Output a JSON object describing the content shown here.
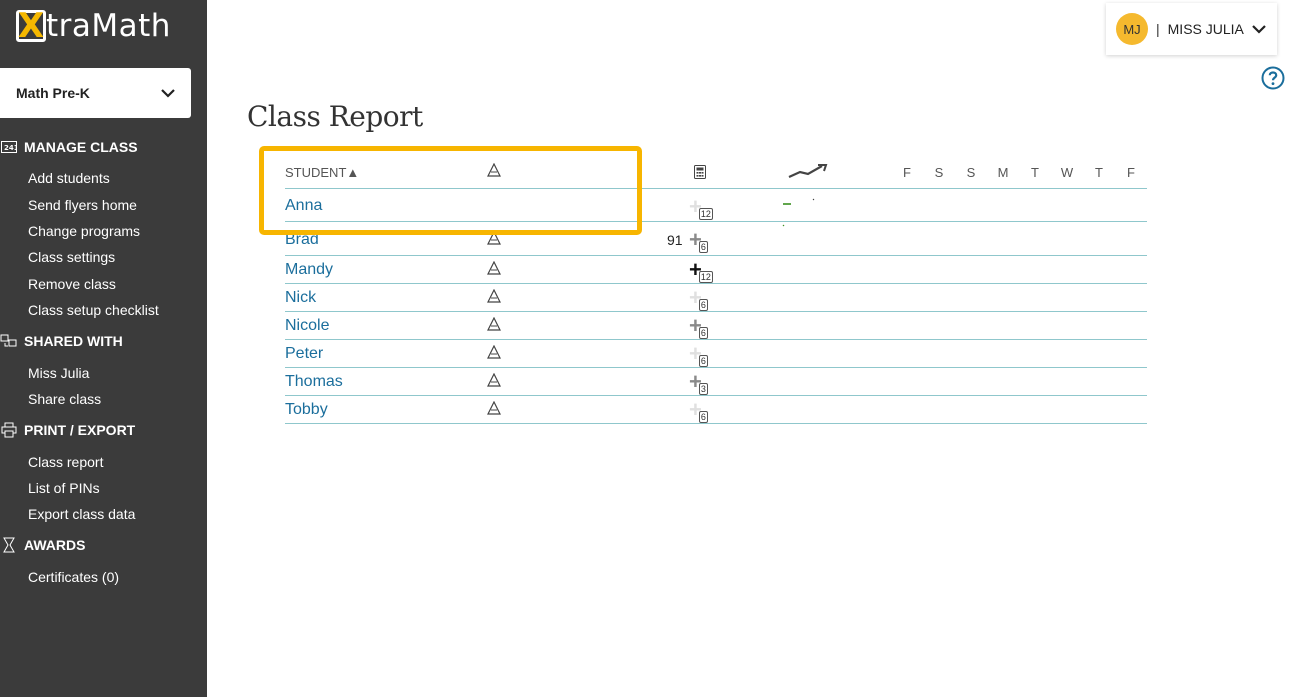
{
  "sidebar": {
    "logo": {
      "mark": "X",
      "text": "traMath"
    },
    "program": "Math Pre-K",
    "sections": [
      {
        "title": "MANAGE CLASS",
        "icon": "class-icon",
        "items": [
          "Add students",
          "Send flyers home",
          "Change programs",
          "Class settings",
          "Remove class",
          "Class setup checklist"
        ]
      },
      {
        "title": "SHARED WITH",
        "icon": "shared-icon",
        "items": [
          "Miss Julia",
          "Share class"
        ]
      },
      {
        "title": "PRINT / EXPORT",
        "icon": "printer-icon",
        "items": [
          "Class report",
          "List of PINs",
          "Export class data"
        ]
      },
      {
        "title": "AWARDS",
        "icon": "trophy-icon",
        "items": [
          "Certificates (0)"
        ]
      }
    ]
  },
  "user": {
    "initials": "MJ",
    "separator": "|",
    "name": "MISS JULIA"
  },
  "page": {
    "title": "Class Report"
  },
  "table": {
    "student_header": "STUDENT▲",
    "days": [
      "F",
      "S",
      "S",
      "M",
      "T",
      "W",
      "T",
      "F"
    ],
    "rows": [
      {
        "name": "Anna",
        "fluency_icon": false,
        "score": "",
        "op_style": "light",
        "badge": "12"
      },
      {
        "name": "Brad",
        "fluency_icon": true,
        "score": "91",
        "op_style": "mid",
        "badge": "6"
      },
      {
        "name": "Mandy",
        "fluency_icon": true,
        "score": "",
        "op_style": "dark",
        "badge": "12"
      },
      {
        "name": "Nick",
        "fluency_icon": true,
        "score": "",
        "op_style": "light",
        "badge": "6"
      },
      {
        "name": "Nicole",
        "fluency_icon": true,
        "score": "",
        "op_style": "mid",
        "badge": "6"
      },
      {
        "name": "Peter",
        "fluency_icon": true,
        "score": "",
        "op_style": "light",
        "badge": "6"
      },
      {
        "name": "Thomas",
        "fluency_icon": true,
        "score": "",
        "op_style": "mid",
        "badge": "3"
      },
      {
        "name": "Tobby",
        "fluency_icon": true,
        "score": "",
        "op_style": "light",
        "badge": "6"
      }
    ]
  },
  "colors": {
    "sidebar": "#3b3b3b",
    "accent": "#f7b500",
    "link": "#1b6e9c",
    "rule": "#8fc7cc",
    "trend_green": "#3a8f1f"
  }
}
